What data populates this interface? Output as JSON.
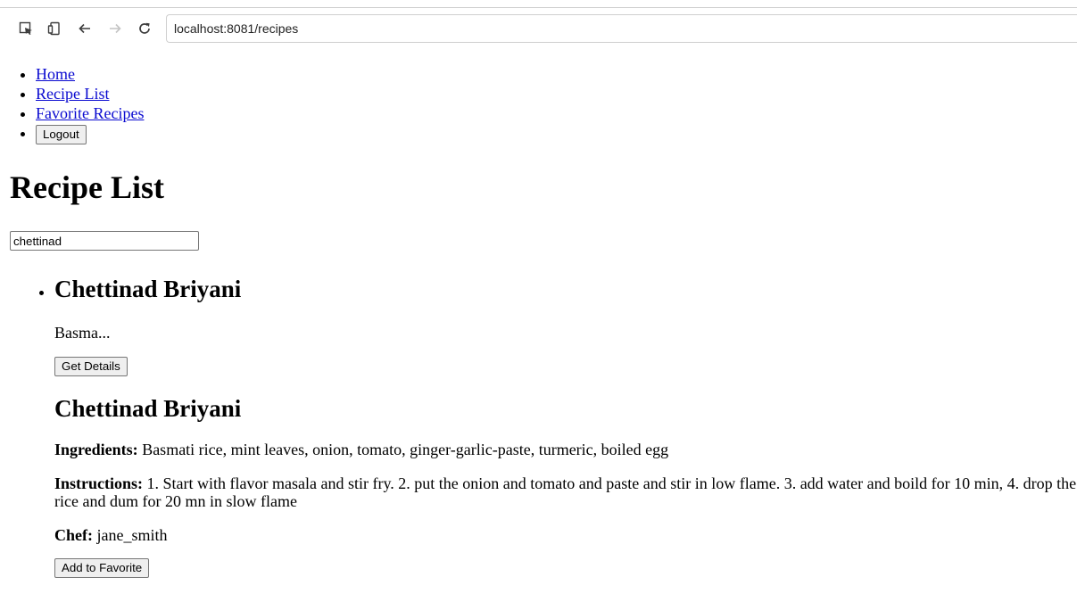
{
  "browser": {
    "url": "localhost:8081/recipes"
  },
  "nav": {
    "home": "Home",
    "recipe_list": "Recipe List",
    "favorites": "Favorite Recipes",
    "logout": "Logout"
  },
  "page": {
    "title": "Recipe List",
    "search_value": "chettinad"
  },
  "results": [
    {
      "name": "Chettinad Briyani",
      "snippet": "Basma...",
      "details_button": "Get Details"
    }
  ],
  "detail": {
    "name": "Chettinad Briyani",
    "ingredients_label": "Ingredients:",
    "ingredients": "Basmati rice, mint leaves, onion, tomato, ginger-garlic-paste, turmeric, boiled egg",
    "instructions_label": "Instructions:",
    "instructions": "1. Start with flavor masala and stir fry. 2. put the onion and tomato and paste and stir in low flame. 3. add water and boild for 10 min, 4. drop the rice and dum for 20 mn in slow flame",
    "chef_label": "Chef:",
    "chef": "jane_smith",
    "favorite_button": "Add to Favorite"
  }
}
